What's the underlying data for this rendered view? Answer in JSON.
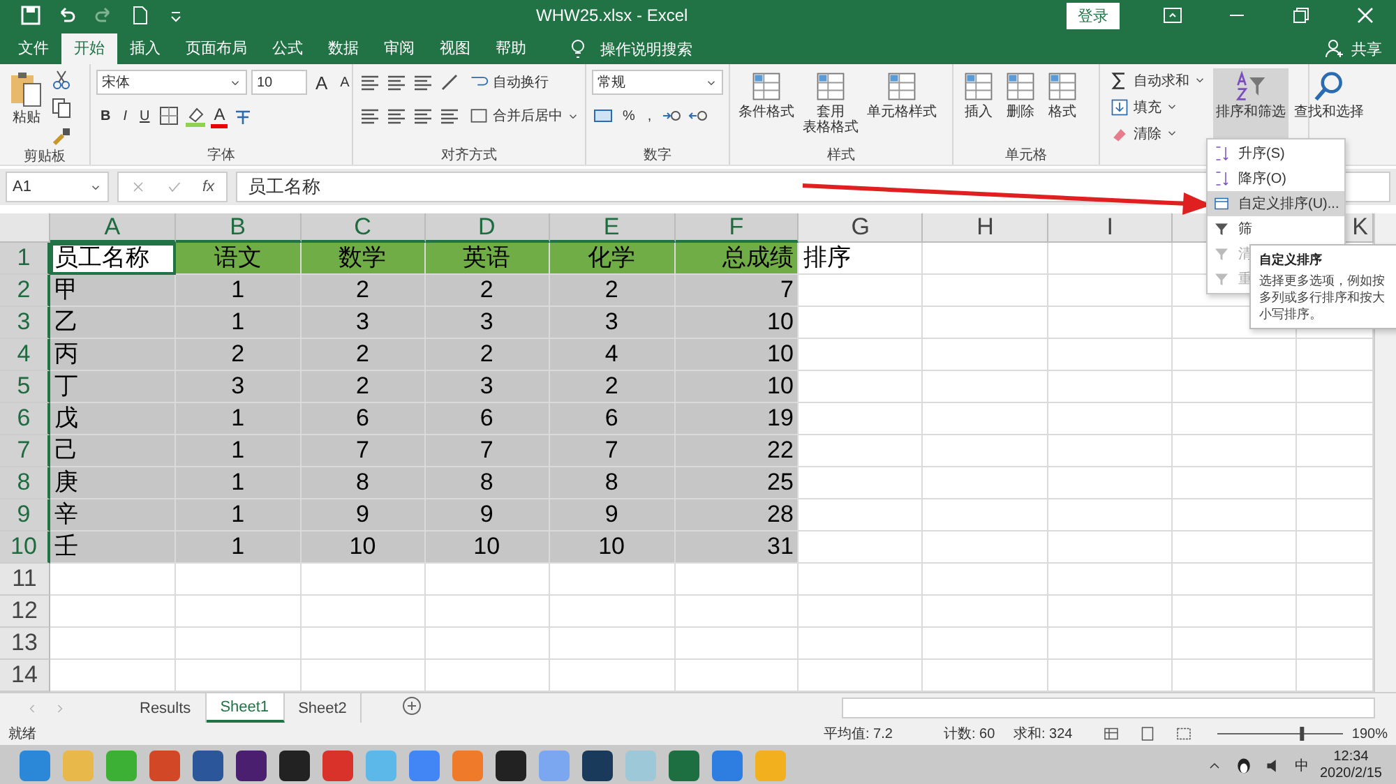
{
  "title_bar": {
    "title": "WHW25.xlsx  -  Excel",
    "login": "登录"
  },
  "tabs": [
    {
      "label": "文件",
      "selected": false
    },
    {
      "label": "开始",
      "selected": true
    },
    {
      "label": "插入",
      "selected": false
    },
    {
      "label": "页面布局",
      "selected": false
    },
    {
      "label": "公式",
      "selected": false
    },
    {
      "label": "数据",
      "selected": false
    },
    {
      "label": "审阅",
      "selected": false
    },
    {
      "label": "视图",
      "selected": false
    },
    {
      "label": "帮助",
      "selected": false
    }
  ],
  "tell_me": "操作说明搜索",
  "share": "共享",
  "ribbon": {
    "groups": [
      {
        "label": "剪贴板",
        "kind": "clipboard",
        "paste": "粘贴"
      },
      {
        "label": "字体",
        "kind": "font",
        "font": "宋体",
        "size": "10",
        "size_buttons": [
          "A",
          "A"
        ],
        "styles": [
          "B",
          "I",
          "U"
        ],
        "font_color": "A"
      },
      {
        "label": "对齐方式",
        "kind": "align",
        "wrap": "自动换行",
        "merge": "合并后居中"
      },
      {
        "label": "数字",
        "kind": "number",
        "format": "常规",
        "symbols": [
          "%",
          ","
        ]
      },
      {
        "label": "样式",
        "kind": "big",
        "buttons": [
          [
            "条件格式"
          ],
          [
            "套用",
            "表格格式"
          ],
          [
            "单元格样式"
          ]
        ]
      },
      {
        "label": "单元格",
        "kind": "big",
        "buttons": [
          [
            "插入"
          ],
          [
            "删除"
          ],
          [
            "格式"
          ]
        ]
      },
      {
        "kind": "editing",
        "items": [
          "自动求和",
          "填充",
          "清除"
        ],
        "buttons": [
          {
            "label": "排序和筛选",
            "selected": true
          },
          {
            "label": "查找和选择",
            "selected": false
          }
        ]
      }
    ]
  },
  "sort_menu": {
    "items": [
      {
        "label": "升序(S)",
        "kind": "asc",
        "selected": false,
        "disabled": false
      },
      {
        "label": "降序(O)",
        "kind": "desc",
        "selected": false,
        "disabled": false
      },
      {
        "label": "自定义排序(U)...",
        "kind": "custom",
        "selected": true,
        "disabled": false
      },
      {
        "label": "筛",
        "kind": "filter",
        "selected": false,
        "disabled": false
      },
      {
        "label": "清",
        "kind": "clear",
        "selected": false,
        "disabled": true
      },
      {
        "label": "重",
        "kind": "reapply",
        "selected": false,
        "disabled": true
      }
    ]
  },
  "tooltip": {
    "title": "自定义排序",
    "text": "选择更多选项，例如按多列或多行排序和按大小写排序。"
  },
  "formula_bar": {
    "name_box": "A1",
    "fx": "fx",
    "formula": "员工名称"
  },
  "grid": {
    "columns": [
      {
        "label": "A",
        "selected": true
      },
      {
        "label": "B",
        "selected": true
      },
      {
        "label": "C",
        "selected": true
      },
      {
        "label": "D",
        "selected": true
      },
      {
        "label": "E",
        "selected": true
      },
      {
        "label": "F",
        "selected": true
      },
      {
        "label": "G",
        "selected": false
      },
      {
        "label": "H",
        "selected": false
      },
      {
        "label": "I",
        "selected": false
      },
      {
        "selected": false
      },
      {
        "label": "K",
        "selected": false
      }
    ],
    "rows": [
      {
        "label": "1",
        "selected": true,
        "cells": [
          {
            "text": "员工名称",
            "active": true
          },
          {
            "text": "语文",
            "color": "#70ad47"
          },
          {
            "text": "数学",
            "color": "#70ad47"
          },
          {
            "text": "英语",
            "color": "#70ad47"
          },
          {
            "text": "化学",
            "color": "#70ad47"
          },
          {
            "text": "总成绩",
            "color": "#70ad47"
          },
          {
            "text": "排序"
          }
        ]
      },
      {
        "label": "2",
        "selected": true,
        "cells": [
          {
            "text": "甲"
          },
          {
            "text": "1"
          },
          {
            "text": "2"
          },
          {
            "text": "2"
          },
          {
            "text": "2"
          },
          {
            "text": "7"
          }
        ]
      },
      {
        "label": "3",
        "selected": true,
        "cells": [
          {
            "text": "乙"
          },
          {
            "text": "1"
          },
          {
            "text": "3"
          },
          {
            "text": "3"
          },
          {
            "text": "3"
          },
          {
            "text": "10"
          }
        ]
      },
      {
        "label": "4",
        "selected": true,
        "cells": [
          {
            "text": "丙"
          },
          {
            "text": "2"
          },
          {
            "text": "2"
          },
          {
            "text": "2"
          },
          {
            "text": "4"
          },
          {
            "text": "10"
          }
        ]
      },
      {
        "label": "5",
        "selected": true,
        "cells": [
          {
            "text": "丁"
          },
          {
            "text": "3"
          },
          {
            "text": "2"
          },
          {
            "text": "3"
          },
          {
            "text": "2"
          },
          {
            "text": "10"
          }
        ]
      },
      {
        "label": "6",
        "selected": true,
        "cells": [
          {
            "text": "戊"
          },
          {
            "text": "1"
          },
          {
            "text": "6"
          },
          {
            "text": "6"
          },
          {
            "text": "6"
          },
          {
            "text": "19"
          }
        ]
      },
      {
        "label": "7",
        "selected": true,
        "cells": [
          {
            "text": "己"
          },
          {
            "text": "1"
          },
          {
            "text": "7"
          },
          {
            "text": "7"
          },
          {
            "text": "7"
          },
          {
            "text": "22"
          }
        ]
      },
      {
        "label": "8",
        "selected": true,
        "cells": [
          {
            "text": "庚"
          },
          {
            "text": "1"
          },
          {
            "text": "8"
          },
          {
            "text": "8"
          },
          {
            "text": "8"
          },
          {
            "text": "25"
          }
        ]
      },
      {
        "label": "9",
        "selected": true,
        "cells": [
          {
            "text": "辛"
          },
          {
            "text": "1"
          },
          {
            "text": "9"
          },
          {
            "text": "9"
          },
          {
            "text": "9"
          },
          {
            "text": "28"
          }
        ]
      },
      {
        "label": "10",
        "selected": true,
        "cells": [
          {
            "text": "壬"
          },
          {
            "text": "1"
          },
          {
            "text": "10"
          },
          {
            "text": "10"
          },
          {
            "text": "10"
          },
          {
            "text": "31"
          }
        ]
      },
      {
        "label": "11",
        "selected": false,
        "cells": []
      },
      {
        "label": "12",
        "selected": false,
        "cells": []
      },
      {
        "label": "13",
        "selected": false,
        "cells": []
      },
      {
        "label": "14",
        "selected": false,
        "cells": []
      }
    ]
  },
  "sheets": [
    {
      "label": "Results",
      "selected": false
    },
    {
      "label": "Sheet1",
      "selected": true
    },
    {
      "label": "Sheet2",
      "selected": false
    }
  ],
  "status_bar": {
    "ready": "就绪",
    "average": "平均值: 7.2",
    "count": "计数: 60",
    "sum": "求和: 324",
    "zoom": "190%",
    "zoom_slider": {
      "level": 0.68
    }
  },
  "taskbar": {
    "ime": "中",
    "time": "12:34",
    "date": "2020/2/15"
  }
}
